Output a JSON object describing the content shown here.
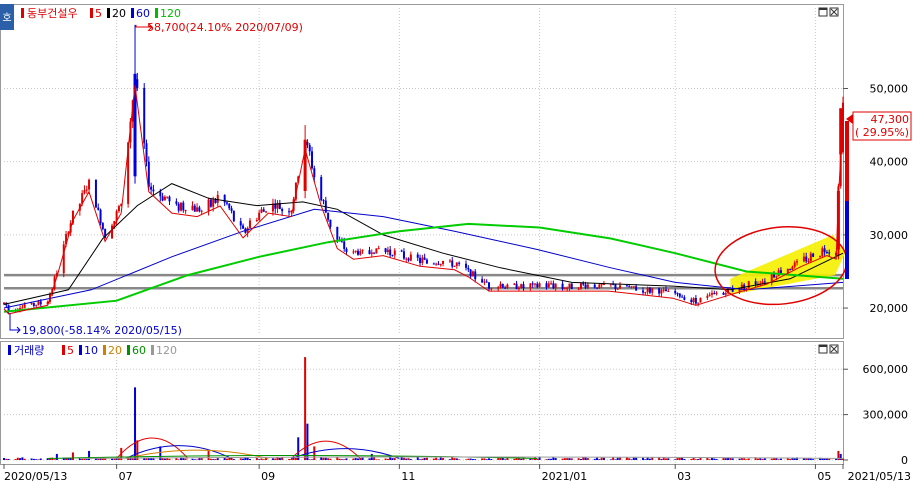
{
  "window": {
    "corner_label": "호"
  },
  "legend_price": {
    "name": "동부건설우",
    "periods": [
      {
        "label": "5",
        "color": "#e00000"
      },
      {
        "label": "20",
        "color": "#000000"
      },
      {
        "label": "60",
        "color": "#0000cc"
      },
      {
        "label": "120",
        "color": "#00bb00"
      }
    ]
  },
  "legend_volume": {
    "name": "거래량",
    "periods": [
      {
        "label": "5",
        "color": "#e00000"
      },
      {
        "label": "10",
        "color": "#0000cc"
      },
      {
        "label": "20",
        "color": "#d08000"
      },
      {
        "label": "60",
        "color": "#009000"
      },
      {
        "label": "120",
        "color": "#999999"
      }
    ]
  },
  "annotations": {
    "high": "58,700(24.10% 2020/07/09)",
    "low": "19,800(-58.14% 2020/05/15)",
    "last_price": "47,300",
    "last_change": "( 29.95%)"
  },
  "colors": {
    "up": "#e00000",
    "down": "#0000dd",
    "ma5": "#e00000",
    "ma20": "#000000",
    "ma60": "#0000cc",
    "ma120": "#00cc00",
    "highlight": "#f4f000",
    "circle": "#e00000",
    "hline": "#888888"
  },
  "chart_data": [
    {
      "type": "candlestick",
      "ylim": [
        17000,
        61000
      ],
      "yticks": [
        20000,
        30000,
        40000,
        50000
      ],
      "ytick_labels": [
        "20,000",
        "30,000",
        "40,000",
        "50,000"
      ],
      "x_start": "2020/05/13",
      "x_end": "2021/05/13",
      "xtick_labels": [
        {
          "date": "2020/05/13",
          "label": "2020/05/13"
        },
        {
          "date": "2020/07",
          "label": "07"
        },
        {
          "date": "2020/09",
          "label": "09"
        },
        {
          "date": "2020/11",
          "label": "11"
        },
        {
          "date": "2021/01",
          "label": "2021/01"
        },
        {
          "date": "2021/03",
          "label": "03"
        },
        {
          "date": "2021/05",
          "label": "05"
        },
        {
          "date": "2021/05/13",
          "label": "2021/05/13"
        }
      ],
      "horizontal_lines": [
        24500,
        22700
      ],
      "price_path": [
        [
          "2020/05/13",
          20500
        ],
        [
          "2020/05/15",
          19800
        ],
        [
          "2020/06/01",
          21000
        ],
        [
          "2020/06/05",
          25000
        ],
        [
          "2020/06/12",
          33000
        ],
        [
          "2020/06/19",
          37000
        ],
        [
          "2020/06/26",
          30000
        ],
        [
          "2020/07/03",
          34000
        ],
        [
          "2020/07/09",
          52000
        ],
        [
          "2020/07/15",
          37000
        ],
        [
          "2020/07/25",
          34000
        ],
        [
          "2020/08/05",
          33500
        ],
        [
          "2020/08/15",
          35000
        ],
        [
          "2020/08/25",
          30500
        ],
        [
          "2020/09/05",
          34000
        ],
        [
          "2020/09/15",
          33500
        ],
        [
          "2020/09/21",
          43000
        ],
        [
          "2020/09/28",
          35000
        ],
        [
          "2020/10/05",
          29000
        ],
        [
          "2020/10/12",
          27500
        ],
        [
          "2020/10/25",
          28000
        ],
        [
          "2020/11/10",
          26500
        ],
        [
          "2020/11/25",
          26000
        ],
        [
          "2020/12/01",
          25000
        ],
        [
          "2020/12/10",
          23000
        ],
        [
          "2020/12/31",
          23000
        ],
        [
          "2021/01/31",
          23000
        ],
        [
          "2021/02/28",
          22000
        ],
        [
          "2021/03/10",
          21000
        ],
        [
          "2021/03/25",
          22500
        ],
        [
          "2021/04/10",
          24000
        ],
        [
          "2021/04/25",
          26500
        ],
        [
          "2021/05/06",
          28000
        ],
        [
          "2021/05/10",
          27500
        ],
        [
          "2021/05/11",
          36000
        ],
        [
          "2021/05/12",
          42000
        ],
        [
          "2021/05/13",
          47300
        ]
      ],
      "moving_averages": [
        {
          "name": "20",
          "points": [
            [
              "2020/05/13",
              20500
            ],
            [
              "2020/06/10",
              22500
            ],
            [
              "2020/06/25",
              29500
            ],
            [
              "2020/07/10",
              34000
            ],
            [
              "2020/07/25",
              37000
            ],
            [
              "2020/08/10",
              35000
            ],
            [
              "2020/08/31",
              34000
            ],
            [
              "2020/09/20",
              34500
            ],
            [
              "2020/10/05",
              33500
            ],
            [
              "2020/10/25",
              30000
            ],
            [
              "2020/11/20",
              27500
            ],
            [
              "2020/12/15",
              25500
            ],
            [
              "2021/01/15",
              23500
            ],
            [
              "2021/02/28",
              23000
            ],
            [
              "2021/03/25",
              22500
            ],
            [
              "2021/04/20",
              24000
            ],
            [
              "2021/05/13",
              27500
            ]
          ]
        },
        {
          "name": "60",
          "points": [
            [
              "2020/05/13",
              20000
            ],
            [
              "2020/06/20",
              22500
            ],
            [
              "2020/07/25",
              27000
            ],
            [
              "2020/08/25",
              30500
            ],
            [
              "2020/09/25",
              33500
            ],
            [
              "2020/10/25",
              32500
            ],
            [
              "2020/11/25",
              30500
            ],
            [
              "2020/12/31",
              28000
            ],
            [
              "2021/02/01",
              25500
            ],
            [
              "2021/03/01",
              23500
            ],
            [
              "2021/04/01",
              22500
            ],
            [
              "2021/05/13",
              23500
            ]
          ]
        },
        {
          "name": "120",
          "points": [
            [
              "2020/05/13",
              19500
            ],
            [
              "2020/07/01",
              21000
            ],
            [
              "2020/08/01",
              24500
            ],
            [
              "2020/09/01",
              27000
            ],
            [
              "2020/10/01",
              29000
            ],
            [
              "2020/11/01",
              30500
            ],
            [
              "2020/12/01",
              31500
            ],
            [
              "2021/01/01",
              31000
            ],
            [
              "2021/02/01",
              29500
            ],
            [
              "2021/03/01",
              27500
            ],
            [
              "2021/04/01",
              25000
            ],
            [
              "2021/05/13",
              24000
            ]
          ]
        }
      ]
    },
    {
      "type": "bar",
      "title": "거래량",
      "ylim": [
        0,
        760000
      ],
      "yticks": [
        0,
        300000,
        600000
      ],
      "ytick_labels": [
        "0",
        "300,000",
        "600,000"
      ],
      "spikes": [
        [
          "2020/06/05",
          40000
        ],
        [
          "2020/06/12",
          50000
        ],
        [
          "2020/06/19",
          60000
        ],
        [
          "2020/07/03",
          80000
        ],
        [
          "2020/07/09",
          480000
        ],
        [
          "2020/07/10",
          130000
        ],
        [
          "2020/07/20",
          90000
        ],
        [
          "2020/08/10",
          60000
        ],
        [
          "2020/09/18",
          150000
        ],
        [
          "2020/09/21",
          680000
        ],
        [
          "2020/09/22",
          240000
        ],
        [
          "2020/09/25",
          90000
        ],
        [
          "2020/10/20",
          40000
        ],
        [
          "2021/05/11",
          60000
        ],
        [
          "2021/05/12",
          40000
        ]
      ],
      "base_volume": 12000
    }
  ]
}
